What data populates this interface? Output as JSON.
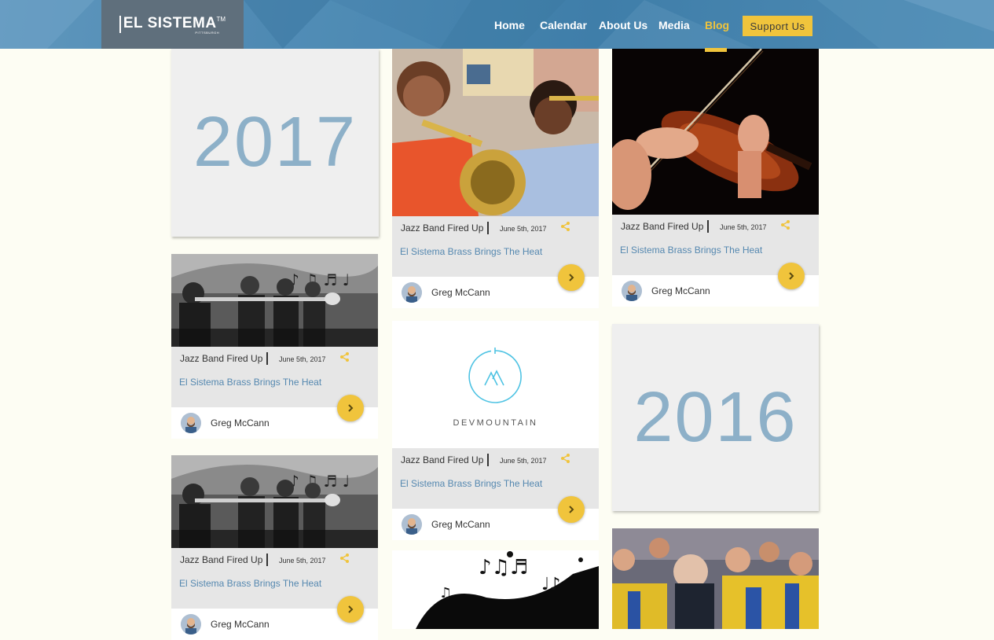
{
  "brand": {
    "name": "EL SISTEMA",
    "tm": "TM",
    "sub": "PITTSBURGH"
  },
  "nav": {
    "items": [
      {
        "label": "Home"
      },
      {
        "label": "Calendar"
      },
      {
        "label": "About Us"
      },
      {
        "label": "Media"
      },
      {
        "label": "Blog",
        "active": true
      }
    ],
    "support_label": "Support Us"
  },
  "years": {
    "y2017": "2017",
    "y2016": "2016"
  },
  "posts": [
    {
      "category": "Jazz Band Fired Up",
      "date": "June 5th, 2017",
      "title": "El Sistema Brass Brings The Heat",
      "author": "Greg McCann",
      "image": "kids-trombone-photo"
    },
    {
      "category": "Jazz Band Fired Up",
      "date": "June 5th, 2017",
      "title": "El Sistema Brass Brings The Heat",
      "author": "Greg McCann",
      "image": "violin-photo"
    },
    {
      "category": "Jazz Band Fired Up",
      "date": "June 5th, 2017",
      "title": "El Sistema Brass Brings The Heat",
      "author": "Greg McCann",
      "image": "trumpet-players-bw-photo"
    },
    {
      "category": "Jazz Band Fired Up",
      "date": "June 5th, 2017",
      "title": "El Sistema Brass Brings The Heat",
      "author": "Greg McCann",
      "image": "devmountain-logo",
      "logo_text": "DEVMOUNTAIN"
    },
    {
      "category": "Jazz Band Fired Up",
      "date": "June 5th, 2017",
      "title": "El Sistema Brass Brings The Heat",
      "author": "Greg McCann",
      "image": "trumpet-players-bw-photo"
    }
  ],
  "colors": {
    "accent": "#f0c43c",
    "header": "#4a86b0",
    "year_text": "#8db0c8",
    "title_link": "#5588b0"
  }
}
